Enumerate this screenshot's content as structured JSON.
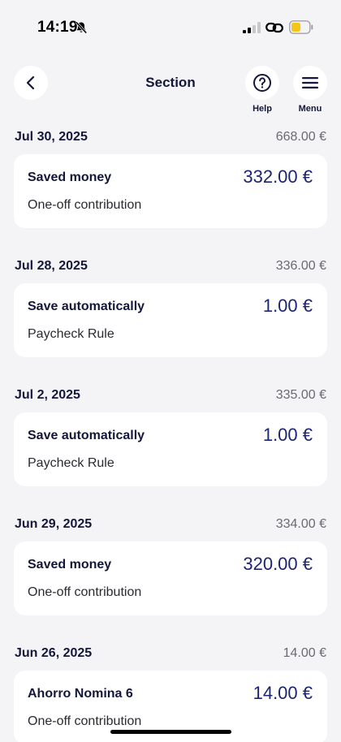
{
  "status_bar": {
    "time": "14:19",
    "battery_color": "#f5c518"
  },
  "header": {
    "title": "Section",
    "help_label": "Help",
    "menu_label": "Menu"
  },
  "transactions": [
    {
      "date": "Jul 30, 2025",
      "balance": "668.00 €",
      "title": "Saved money",
      "subtitle": "One-off contribution",
      "amount": "332.00 €"
    },
    {
      "date": "Jul 28, 2025",
      "balance": "336.00 €",
      "title": "Save automatically",
      "subtitle": "Paycheck Rule",
      "amount": "1.00 €"
    },
    {
      "date": "Jul 2, 2025",
      "balance": "335.00 €",
      "title": "Save automatically",
      "subtitle": "Paycheck Rule",
      "amount": "1.00 €"
    },
    {
      "date": "Jun 29, 2025",
      "balance": "334.00 €",
      "title": "Saved money",
      "subtitle": "One-off contribution",
      "amount": "320.00 €"
    },
    {
      "date": "Jun 26, 2025",
      "balance": "14.00 €",
      "title": "Ahorro Nomina 6",
      "subtitle": "One-off contribution",
      "amount": "14.00 €"
    }
  ],
  "colors": {
    "background": "#f4f4f6",
    "card": "#ffffff",
    "navy": "#14173a",
    "amount": "#1d2470",
    "muted": "#6a6a72"
  }
}
